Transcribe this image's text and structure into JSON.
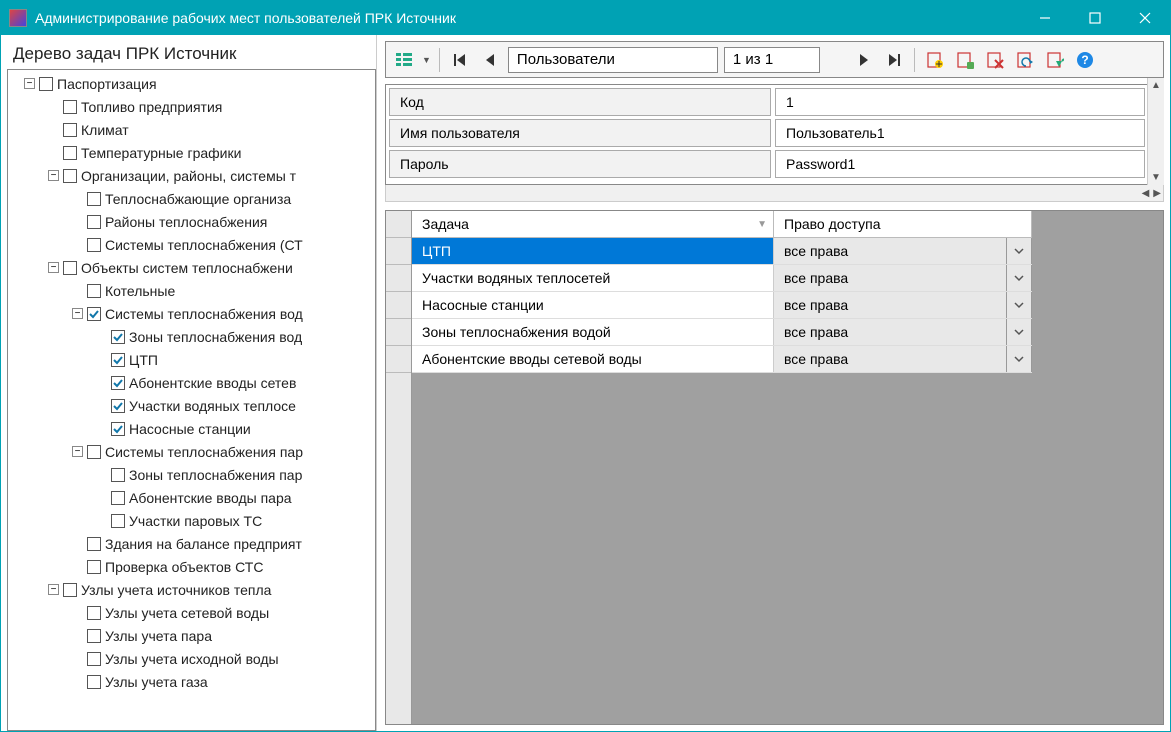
{
  "window": {
    "title": "Администрирование рабочих мест пользователей ПРК Источник"
  },
  "left": {
    "header": "Дерево задач ПРК Источник",
    "tree": [
      {
        "level": 0,
        "expand": "-",
        "checked": false,
        "label": "Паспортизация"
      },
      {
        "level": 1,
        "expand": "",
        "checked": false,
        "label": "Топливо предприятия"
      },
      {
        "level": 1,
        "expand": "",
        "checked": false,
        "label": "Климат"
      },
      {
        "level": 1,
        "expand": "",
        "checked": false,
        "label": "Температурные графики"
      },
      {
        "level": 1,
        "expand": "-",
        "checked": false,
        "label": "Организации, районы, системы т"
      },
      {
        "level": 2,
        "expand": "",
        "checked": false,
        "label": "Теплоснабжающие организа"
      },
      {
        "level": 2,
        "expand": "",
        "checked": false,
        "label": "Районы теплоснабжения"
      },
      {
        "level": 2,
        "expand": "",
        "checked": false,
        "label": "Системы теплоснабжения (СТ"
      },
      {
        "level": 1,
        "expand": "-",
        "checked": false,
        "label": "Объекты систем теплоснабжени"
      },
      {
        "level": 2,
        "expand": "",
        "checked": false,
        "label": "Котельные"
      },
      {
        "level": 2,
        "expand": "-",
        "checked": true,
        "label": "Системы теплоснабжения вод"
      },
      {
        "level": 3,
        "expand": "",
        "checked": true,
        "label": "Зоны теплоснабжения вод"
      },
      {
        "level": 3,
        "expand": "",
        "checked": true,
        "label": "ЦТП"
      },
      {
        "level": 3,
        "expand": "",
        "checked": true,
        "label": "Абонентские вводы сетев"
      },
      {
        "level": 3,
        "expand": "",
        "checked": true,
        "label": "Участки водяных теплосе"
      },
      {
        "level": 3,
        "expand": "",
        "checked": true,
        "label": "Насосные станции"
      },
      {
        "level": 2,
        "expand": "-",
        "checked": false,
        "label": "Системы теплоснабжения пар"
      },
      {
        "level": 3,
        "expand": "",
        "checked": false,
        "label": "Зоны теплоснабжения пар"
      },
      {
        "level": 3,
        "expand": "",
        "checked": false,
        "label": "Абонентские вводы пара"
      },
      {
        "level": 3,
        "expand": "",
        "checked": false,
        "label": "Участки паровых ТС"
      },
      {
        "level": 2,
        "expand": "",
        "checked": false,
        "label": "Здания на балансе предприят"
      },
      {
        "level": 2,
        "expand": "",
        "checked": false,
        "label": "Проверка объектов СТС"
      },
      {
        "level": 1,
        "expand": "-",
        "checked": false,
        "label": "Узлы учета источников тепла"
      },
      {
        "level": 2,
        "expand": "",
        "checked": false,
        "label": "Узлы учета сетевой воды"
      },
      {
        "level": 2,
        "expand": "",
        "checked": false,
        "label": "Узлы учета пара"
      },
      {
        "level": 2,
        "expand": "",
        "checked": false,
        "label": "Узлы учета исходной воды"
      },
      {
        "level": 2,
        "expand": "",
        "checked": false,
        "label": "Узлы учета газа"
      }
    ]
  },
  "toolbar": {
    "entity": "Пользователи",
    "position": "1 из 1"
  },
  "form": {
    "rows": [
      {
        "label": "Код",
        "value": "1"
      },
      {
        "label": "Имя пользователя",
        "value": "Пользователь1"
      },
      {
        "label": "Пароль",
        "value": "Password1"
      }
    ]
  },
  "grid": {
    "headers": {
      "task": "Задача",
      "right": "Право доступа"
    },
    "rows": [
      {
        "task": "ЦТП",
        "right": "все права",
        "selected": true
      },
      {
        "task": "Участки водяных теплосетей",
        "right": "все права",
        "selected": false
      },
      {
        "task": "Насосные станции",
        "right": "все права",
        "selected": false
      },
      {
        "task": "Зоны теплоснабжения водой",
        "right": "все права",
        "selected": false
      },
      {
        "task": "Абонентские вводы сетевой воды",
        "right": "все права",
        "selected": false
      }
    ]
  }
}
